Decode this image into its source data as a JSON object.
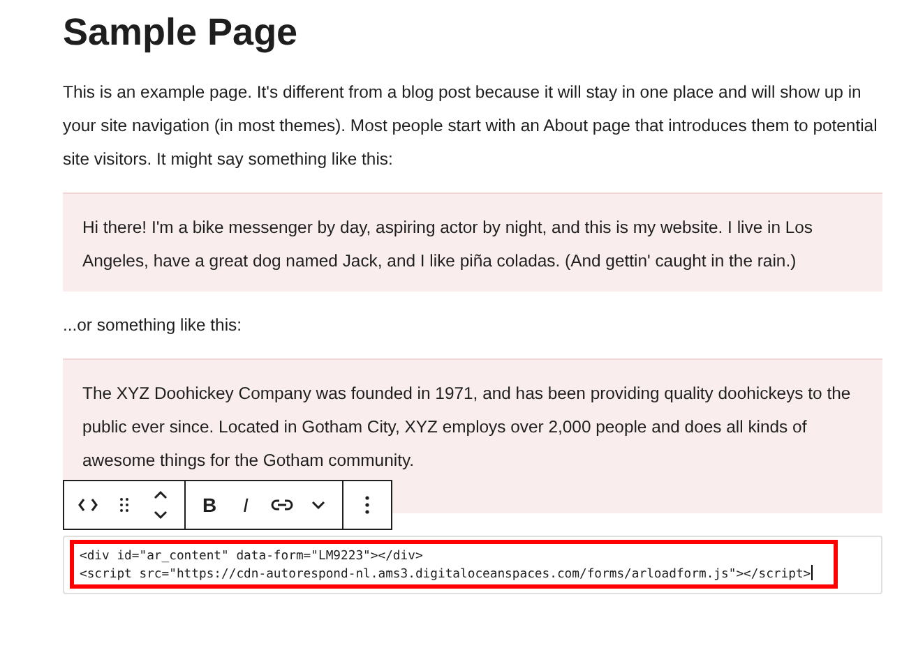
{
  "title": "Sample Page",
  "blocks": [
    {
      "kind": "paragraph",
      "text": "This is an example page. It's different from a blog post because it will stay in one place and will show up in your site navigation (in most themes). Most people start with an About page that introduces them to potential site visitors. It might say something like this:"
    },
    {
      "kind": "quote",
      "text": "Hi there! I'm a bike messenger by day, aspiring actor by night, and this is my website. I live in Los Angeles, have a great dog named Jack, and I like piña coladas. (And gettin' caught in the rain.)"
    },
    {
      "kind": "paragraph",
      "text": "...or something like this:"
    },
    {
      "kind": "quote",
      "text": "The XYZ Doohickey Company was founded in 1971, and has been providing quality doohickeys to the public ever since. Located in Gotham City, XYZ employs over 2,000 people and does all kinds of awesome things for the Gotham community."
    }
  ],
  "toolbar": [
    [
      {
        "kind": "html"
      },
      {
        "kind": "drag"
      },
      {
        "kind": "move"
      }
    ],
    [
      {
        "kind": "bold",
        "label": "B"
      },
      {
        "kind": "italic",
        "label": "I"
      },
      {
        "kind": "link"
      },
      {
        "kind": "more"
      }
    ],
    [
      {
        "kind": "options"
      }
    ]
  ],
  "code_block": {
    "lines": [
      "<div id=\"ar_content\" data-form=\"LM9223\"></div>",
      "<script src=\"https://cdn-autorespond-nl.ams3.digitaloceanspaces.com/forms/arloadform.js\"></script>"
    ]
  }
}
